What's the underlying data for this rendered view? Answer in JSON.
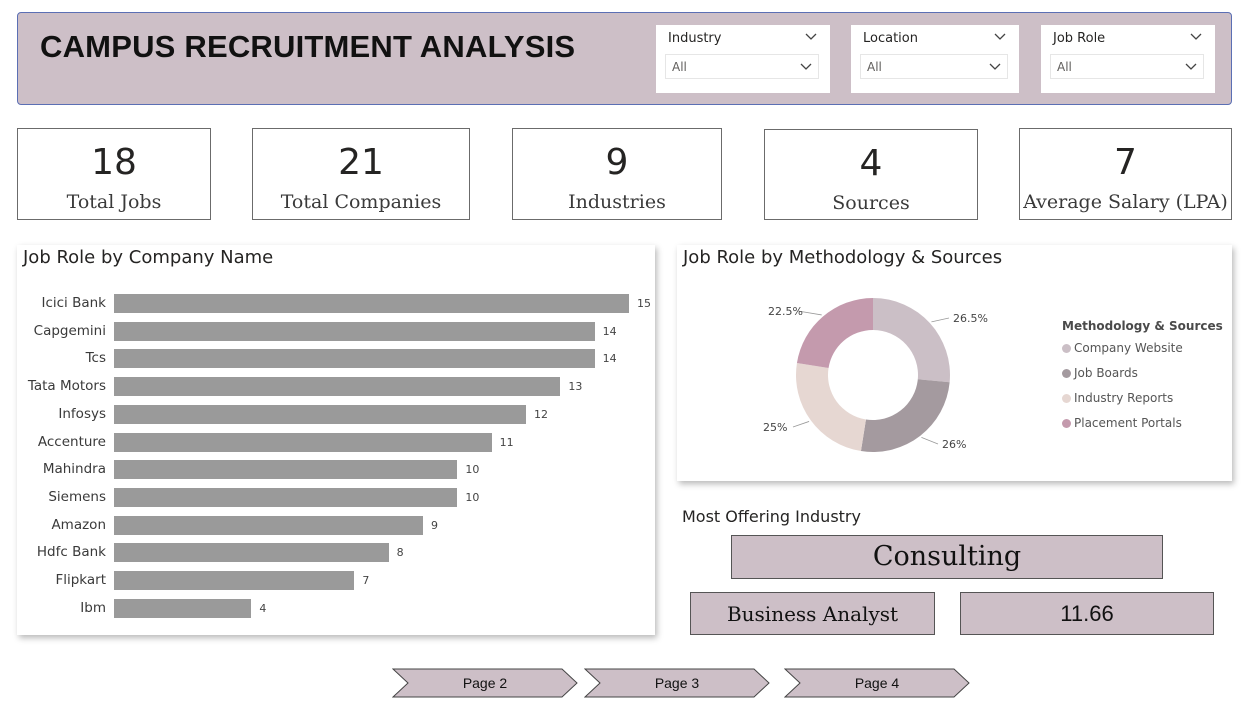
{
  "header": {
    "title": "CAMPUS RECRUITMENT ANALYSIS",
    "slicers": [
      {
        "label": "Industry",
        "value": "All"
      },
      {
        "label": "Location",
        "value": "All"
      },
      {
        "label": "Job Role",
        "value": "All"
      }
    ]
  },
  "kpis": [
    {
      "value": "18",
      "label": "Total Jobs"
    },
    {
      "value": "21",
      "label": "Total Companies"
    },
    {
      "value": "9",
      "label": "Industries"
    },
    {
      "value": "4",
      "label": "Sources"
    },
    {
      "value": "7",
      "label": "Average Salary (LPA)"
    }
  ],
  "bar_panel": {
    "title": "Job Role by Company Name"
  },
  "donut_panel": {
    "title": "Job Role by Methodology & Sources",
    "legend_title": "Methodology & Sources"
  },
  "chart_data": [
    {
      "type": "bar",
      "orientation": "horizontal",
      "title": "Job Role by Company Name",
      "categories": [
        "Icici Bank",
        "Capgemini",
        "Tcs",
        "Tata Motors",
        "Infosys",
        "Accenture",
        "Mahindra",
        "Siemens",
        "Amazon",
        "Hdfc Bank",
        "Flipkart",
        "Ibm"
      ],
      "values": [
        15,
        14,
        14,
        13,
        12,
        11,
        10,
        10,
        9,
        8,
        7,
        4
      ],
      "color": "#9a9a9a",
      "grid": false
    },
    {
      "type": "pie",
      "variant": "donut",
      "title": "Job Role by Methodology & Sources",
      "legend_title": "Methodology & Sources",
      "legend_position": "right",
      "categories": [
        "Company Website",
        "Job Boards",
        "Industry Reports",
        "Placement Portals"
      ],
      "values": [
        26.5,
        26,
        25,
        22.5
      ],
      "labels": [
        "26.5%",
        "26%",
        "25%",
        "22.5%"
      ],
      "colors": [
        "#cbbfc6",
        "#a49a9f",
        "#e6d7d2",
        "#c49aad"
      ]
    }
  ],
  "most_offering": {
    "label": "Most Offering Industry",
    "industry": "Consulting",
    "job_role": "Business Analyst",
    "value": "11.66"
  },
  "nav": {
    "buttons": [
      "Page 2",
      "Page 3",
      "Page 4"
    ]
  },
  "colors": {
    "header_bg": "#cdbfc7",
    "card_bg": "#cdbfc7",
    "header_border": "#5b6fb4"
  }
}
